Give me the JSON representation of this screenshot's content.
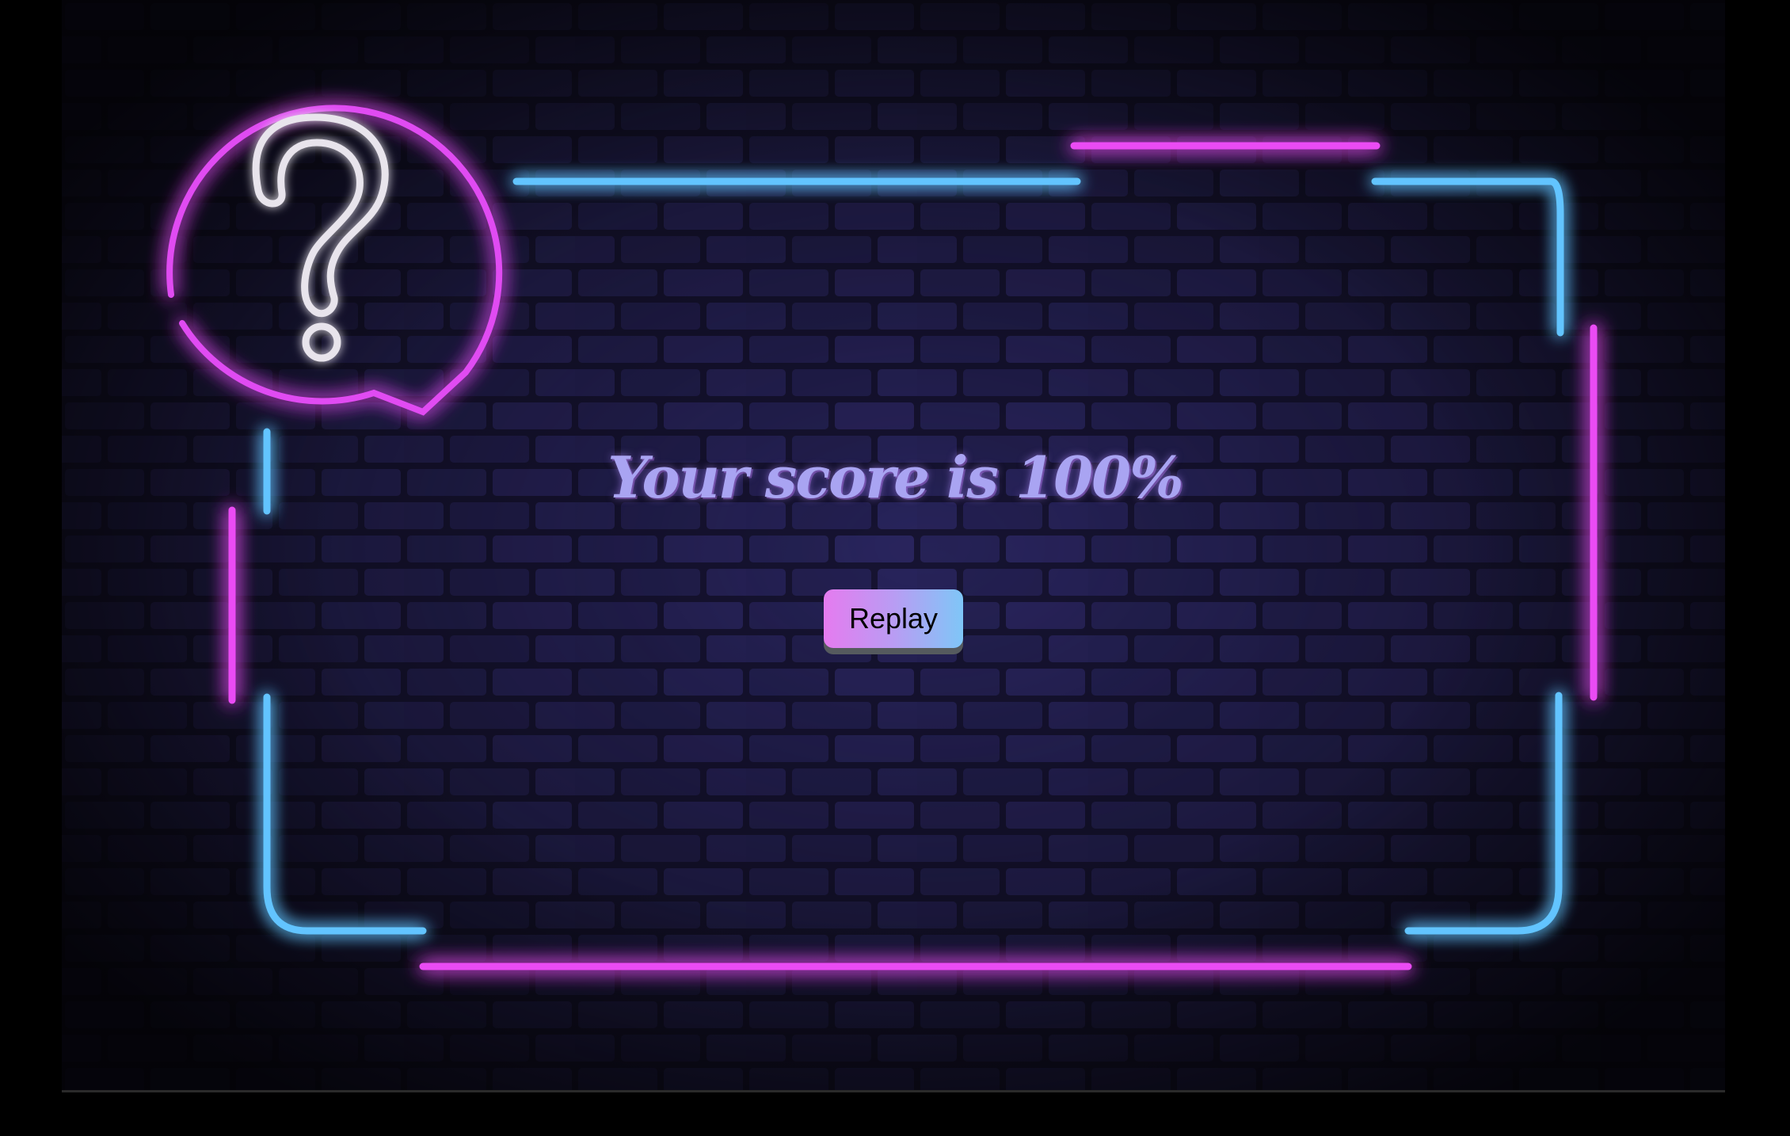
{
  "result": {
    "score_label": "Your score is 100%",
    "score_percent": 100
  },
  "actions": {
    "replay_label": "Replay"
  },
  "colors": {
    "neon_pink": "#e040f0",
    "neon_blue": "#5ab8ff",
    "score_text": "#a9a4f2",
    "button_gradient_start": "#e57bef",
    "button_gradient_end": "#7fc6f7"
  },
  "icons": {
    "speech_bubble": "question-mark-speech-bubble-icon"
  }
}
